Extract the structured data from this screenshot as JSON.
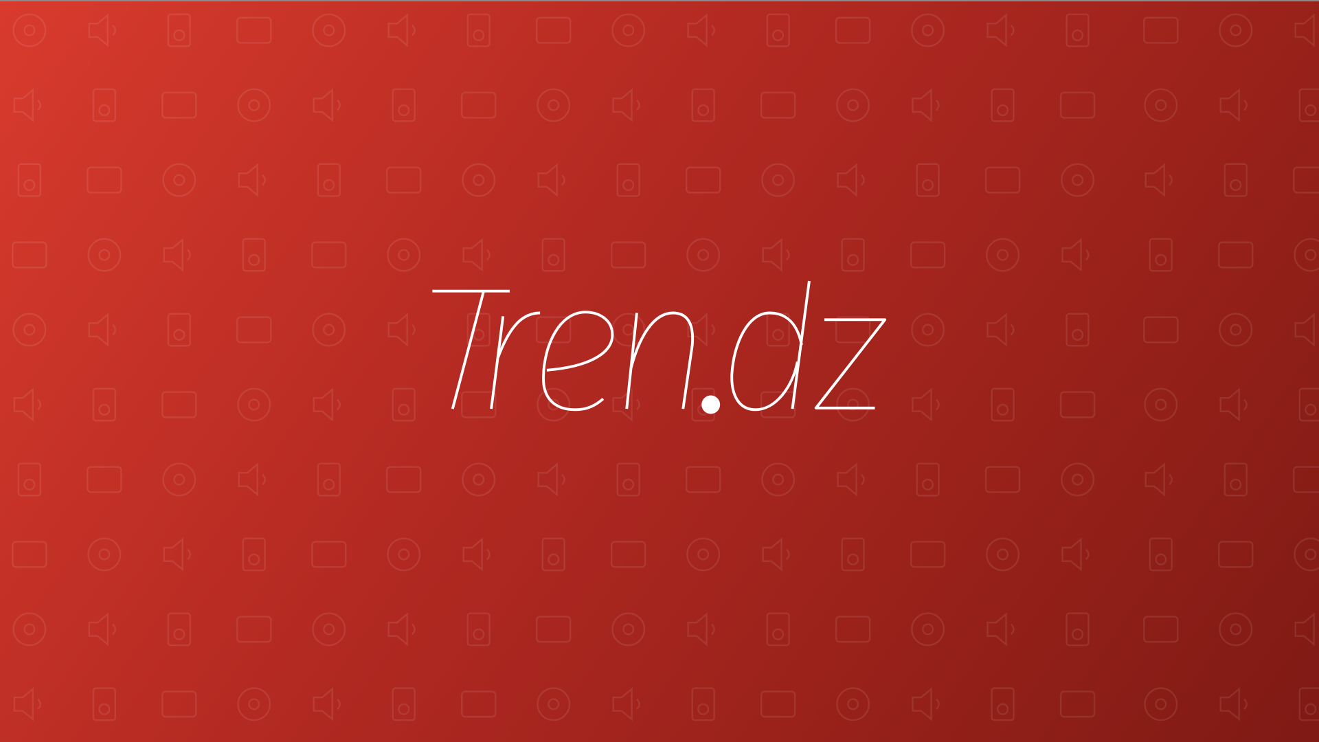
{
  "logo": {
    "text": "Tren.dz"
  },
  "background": {
    "pattern": "electronics-media-icons",
    "icon_columns": 18,
    "icon_rows": 10
  },
  "colors": {
    "gradient_start": "#d83b2d",
    "gradient_end": "#7f1a14",
    "logo": "#ffffff"
  }
}
